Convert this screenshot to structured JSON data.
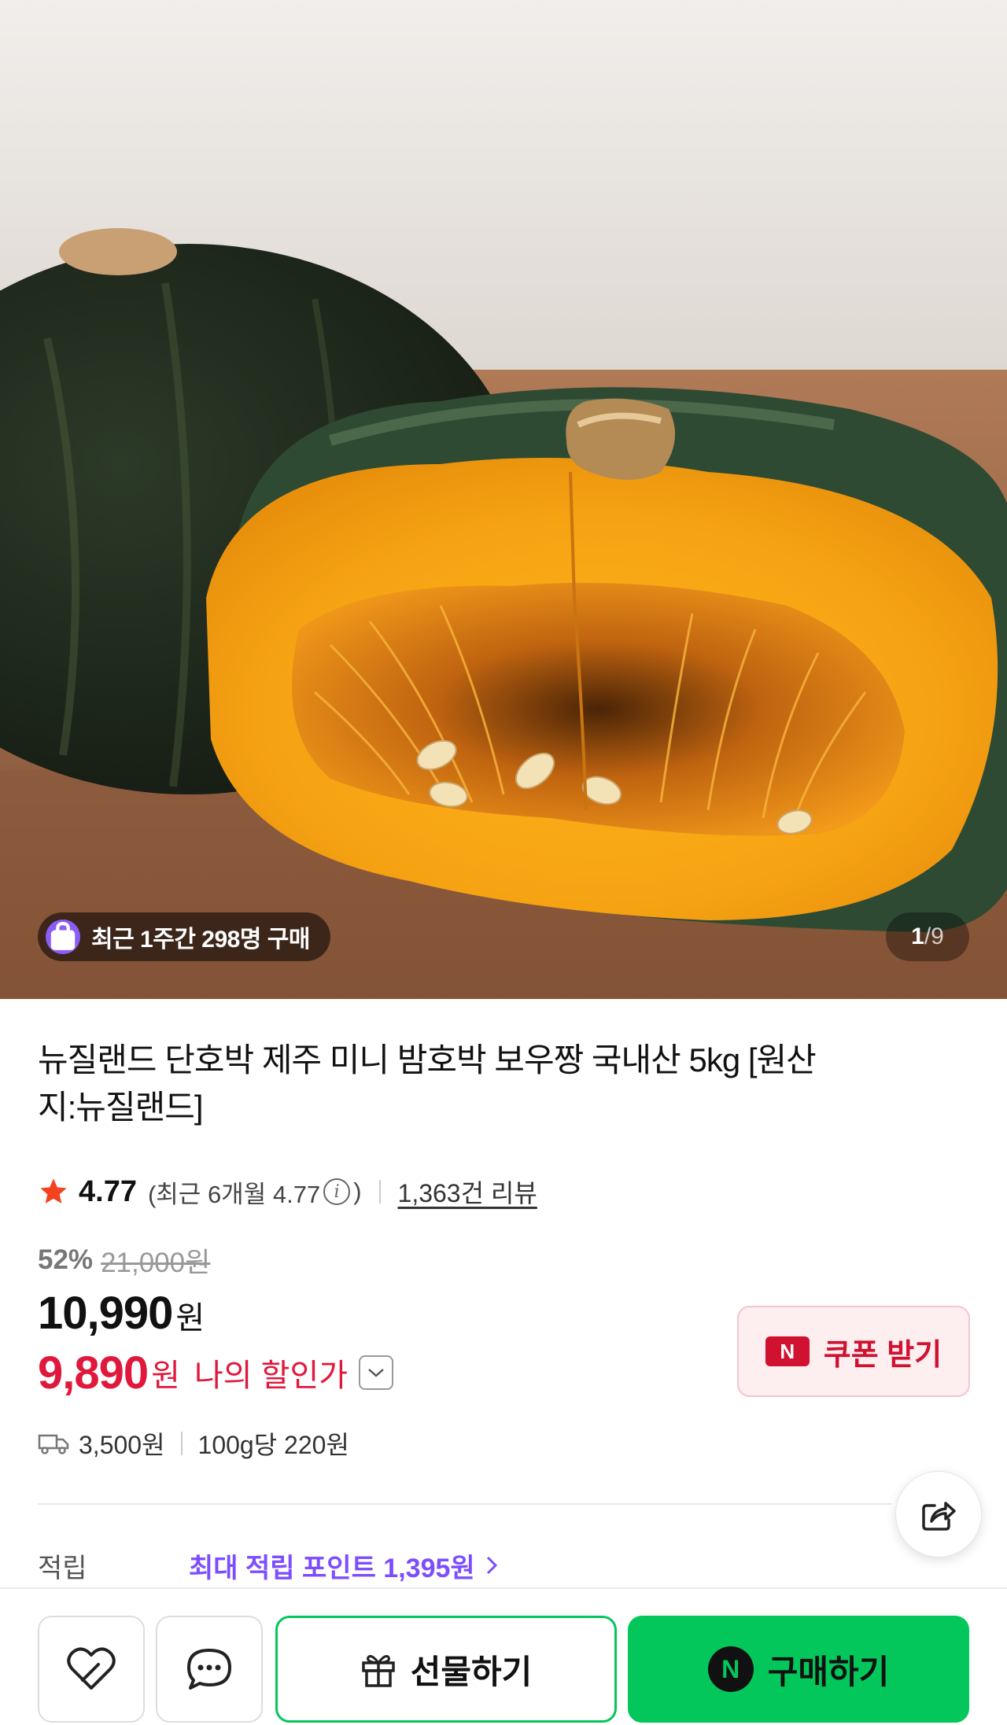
{
  "gallery": {
    "recent_buyers": "최근 1주간 298명 구매",
    "current_index": "1",
    "separator": "/",
    "total": "9"
  },
  "product": {
    "title": "뉴질랜드 단호박 제주 미니 밤호박 보우짱 국내산 5kg [원산지:뉴질랜드]",
    "rating": "4.77",
    "recent_rating": "(최근 6개월 4.77",
    "recent_rating_close": ")",
    "review_count": "1,363건 리뷰",
    "discount_percent": "52%",
    "original_price": "21,000원",
    "price": "10,990",
    "price_unit": "원",
    "my_discount_price": "9,890",
    "my_discount_unit": "원",
    "my_discount_label": "나의 할인가",
    "shipping_fee": "3,500원",
    "unit_price": "100g당 220원",
    "points_label": "적립",
    "points_value": "최대 적립 포인트 1,395원"
  },
  "coupon": {
    "badge": "N",
    "label": "쿠폰 받기"
  },
  "bottom_bar": {
    "gift_label": "선물하기",
    "buy_badge": "N",
    "buy_label": "구매하기"
  },
  "colors": {
    "naver_green": "#03c75a",
    "discount_red": "#e0183c",
    "points_purple": "#7c4dff",
    "star": "#f4421f"
  }
}
